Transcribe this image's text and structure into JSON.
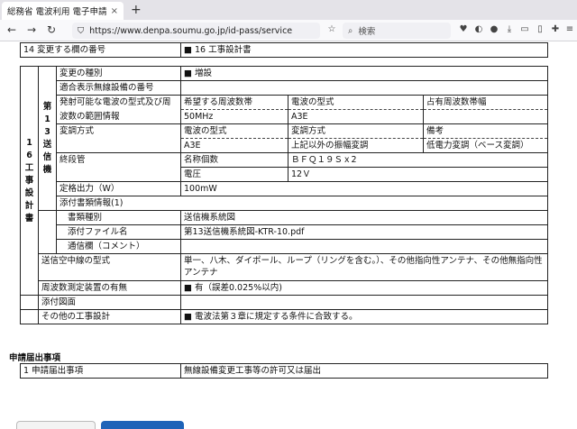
{
  "browser": {
    "tab_title": "総務省 電波利用 電子申請・",
    "tab_close": "×",
    "new_tab": "+",
    "url": "https://www.denpa.soumu.go.jp/id-pass/service",
    "search_placeholder": "検索"
  },
  "top_row": {
    "label": "14 変更する欄の番号",
    "value": "■ 16 工事設計書"
  },
  "section16": {
    "side_label": "16工事設計書",
    "sub_label": "第13送信機",
    "change_type_label": "変更の種別",
    "change_type_value": "■ 増設",
    "cert_label": "適合表示無線設備の番号",
    "cert_value": "",
    "emission_label": "発射可能な電波の型式及び周",
    "freq_label": "波数の範囲情報",
    "emission_headers": [
      "希望する周波数帯",
      "電波の型式",
      "占有周波数帯幅"
    ],
    "emission_values": [
      "50MHz",
      "A3E",
      ""
    ],
    "modulation_label": "変調方式",
    "modulation_headers": [
      "電波の型式",
      "変調方式",
      "備考"
    ],
    "modulation_values": [
      "A3E",
      "上記以外の振幅変調",
      "低電力変調（ベース変調）"
    ],
    "final_stage_label": "終段管",
    "device_name_label": "名称個数",
    "device_name_value": "ＢＦＱ１９Ｓｘ2",
    "voltage_label": "電圧",
    "voltage_value": "12Ｖ",
    "power_label": "定格出力（W）",
    "power_value": "100mW",
    "attach_label": "添付書類情報(1)",
    "doc_type_label": "書類種別",
    "doc_type_value": "送信機系統図",
    "file_label": "添付ファイル名",
    "file_value": "第13送信機系統図-KTR-10.pdf",
    "comment_label": "通信欄（コメント）",
    "comment_value": "",
    "antenna_label": "送信空中線の型式",
    "antenna_value": "単一、八木、ダイポール、ループ（リングを含む。）、その他指向性アンテナ、その他無指向性アンテナ",
    "freqmeter_label": "周波数測定装置の有無",
    "freqmeter_value": "■ 有（誤差0.025%以内)",
    "drawing_label": "添付図面",
    "drawing_value": "",
    "other_label": "その他の工事設計",
    "other_value": "■ 電波法第３章に規定する条件に合致する。"
  },
  "application": {
    "title": "申請届出事項",
    "row_label": "1 申請届出事項",
    "row_value": "無線設備変更工事等の許可又は届出"
  }
}
